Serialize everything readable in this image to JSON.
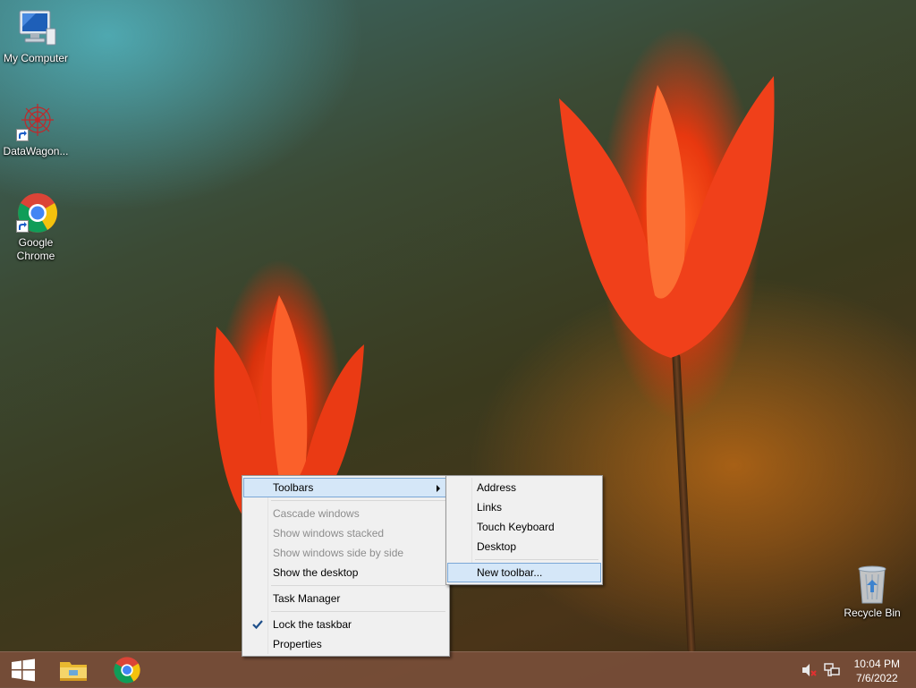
{
  "desktop": {
    "icons": [
      {
        "label": "My Computer"
      },
      {
        "label": "DataWagon..."
      },
      {
        "label": "Google Chrome"
      },
      {
        "label": "Recycle Bin"
      }
    ]
  },
  "context_menu": {
    "items": [
      {
        "label": "Toolbars",
        "state": "highlighted",
        "has_submenu": true
      },
      {
        "label": "Cascade windows",
        "state": "disabled"
      },
      {
        "label": "Show windows stacked",
        "state": "disabled"
      },
      {
        "label": "Show windows side by side",
        "state": "disabled"
      },
      {
        "label": "Show the desktop",
        "state": "enabled"
      },
      {
        "label": "Task Manager",
        "state": "enabled"
      },
      {
        "label": "Lock the taskbar",
        "state": "checked"
      },
      {
        "label": "Properties",
        "state": "enabled"
      }
    ]
  },
  "toolbars_submenu": {
    "items": [
      {
        "label": "Address"
      },
      {
        "label": "Links"
      },
      {
        "label": "Touch Keyboard"
      },
      {
        "label": "Desktop"
      },
      {
        "label": "New toolbar...",
        "state": "highlighted"
      }
    ]
  },
  "taskbar": {
    "pinned": [
      {
        "icon": "windows-start-icon"
      },
      {
        "icon": "file-explorer-icon"
      },
      {
        "icon": "chrome-icon"
      }
    ],
    "tray": {
      "icons": [
        "volume-muted-icon",
        "network-icon"
      ],
      "time": "10:04 PM",
      "date": "7/6/2022"
    }
  },
  "colors": {
    "taskbar": "#784e3a",
    "menu_bg": "#f0f0f0",
    "menu_highlight": "#d5e7f8",
    "menu_highlight_border": "#7aa7d6",
    "disabled_text": "#8d8d8d"
  }
}
